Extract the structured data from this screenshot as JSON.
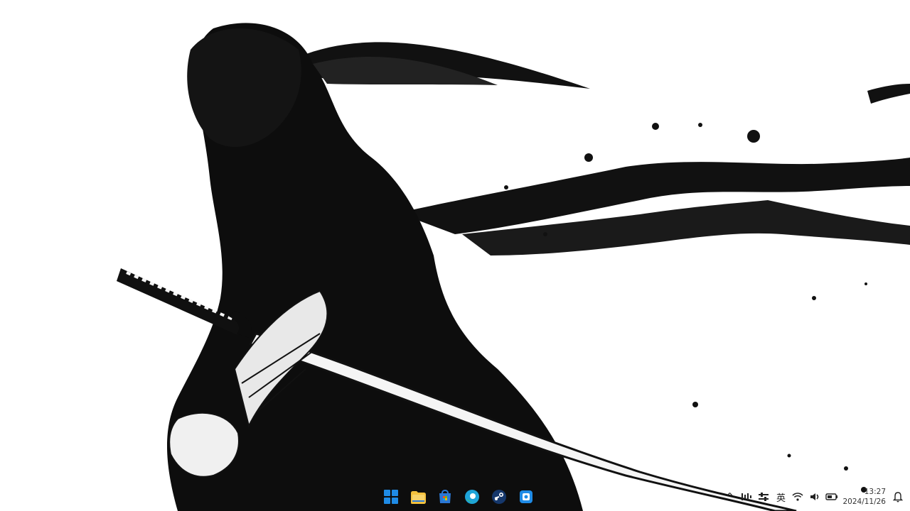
{
  "taskbar": {
    "apps": [
      {
        "icon": "windows-start-icon"
      },
      {
        "icon": "file-explorer-icon"
      },
      {
        "icon": "microsoft-store-icon"
      },
      {
        "icon": "edge-browser-icon"
      },
      {
        "icon": "steam-icon"
      },
      {
        "icon": "app-icon"
      }
    ],
    "tray": {
      "chevron": "^",
      "ime": "英",
      "time": "13:27",
      "date": "2024/11/26"
    }
  },
  "colors": {
    "ink": "#0d0d0d",
    "start_blue": "#1f8be6",
    "folder_yellow": "#f4c13d",
    "store_blue": "#2b78d6",
    "edge_blue": "#1ea4d9",
    "edge_green": "#41c26b",
    "steam_blue": "#15376b"
  }
}
